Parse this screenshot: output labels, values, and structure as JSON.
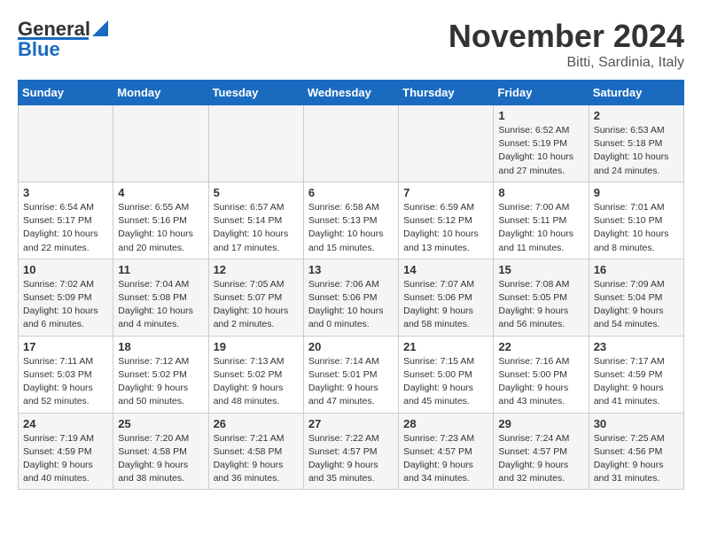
{
  "header": {
    "logo_general": "General",
    "logo_blue": "Blue",
    "month": "November 2024",
    "location": "Bitti, Sardinia, Italy"
  },
  "days_of_week": [
    "Sunday",
    "Monday",
    "Tuesday",
    "Wednesday",
    "Thursday",
    "Friday",
    "Saturday"
  ],
  "weeks": [
    [
      {
        "day": "",
        "info": ""
      },
      {
        "day": "",
        "info": ""
      },
      {
        "day": "",
        "info": ""
      },
      {
        "day": "",
        "info": ""
      },
      {
        "day": "",
        "info": ""
      },
      {
        "day": "1",
        "info": "Sunrise: 6:52 AM\nSunset: 5:19 PM\nDaylight: 10 hours\nand 27 minutes."
      },
      {
        "day": "2",
        "info": "Sunrise: 6:53 AM\nSunset: 5:18 PM\nDaylight: 10 hours\nand 24 minutes."
      }
    ],
    [
      {
        "day": "3",
        "info": "Sunrise: 6:54 AM\nSunset: 5:17 PM\nDaylight: 10 hours\nand 22 minutes."
      },
      {
        "day": "4",
        "info": "Sunrise: 6:55 AM\nSunset: 5:16 PM\nDaylight: 10 hours\nand 20 minutes."
      },
      {
        "day": "5",
        "info": "Sunrise: 6:57 AM\nSunset: 5:14 PM\nDaylight: 10 hours\nand 17 minutes."
      },
      {
        "day": "6",
        "info": "Sunrise: 6:58 AM\nSunset: 5:13 PM\nDaylight: 10 hours\nand 15 minutes."
      },
      {
        "day": "7",
        "info": "Sunrise: 6:59 AM\nSunset: 5:12 PM\nDaylight: 10 hours\nand 13 minutes."
      },
      {
        "day": "8",
        "info": "Sunrise: 7:00 AM\nSunset: 5:11 PM\nDaylight: 10 hours\nand 11 minutes."
      },
      {
        "day": "9",
        "info": "Sunrise: 7:01 AM\nSunset: 5:10 PM\nDaylight: 10 hours\nand 8 minutes."
      }
    ],
    [
      {
        "day": "10",
        "info": "Sunrise: 7:02 AM\nSunset: 5:09 PM\nDaylight: 10 hours\nand 6 minutes."
      },
      {
        "day": "11",
        "info": "Sunrise: 7:04 AM\nSunset: 5:08 PM\nDaylight: 10 hours\nand 4 minutes."
      },
      {
        "day": "12",
        "info": "Sunrise: 7:05 AM\nSunset: 5:07 PM\nDaylight: 10 hours\nand 2 minutes."
      },
      {
        "day": "13",
        "info": "Sunrise: 7:06 AM\nSunset: 5:06 PM\nDaylight: 10 hours\nand 0 minutes."
      },
      {
        "day": "14",
        "info": "Sunrise: 7:07 AM\nSunset: 5:06 PM\nDaylight: 9 hours\nand 58 minutes."
      },
      {
        "day": "15",
        "info": "Sunrise: 7:08 AM\nSunset: 5:05 PM\nDaylight: 9 hours\nand 56 minutes."
      },
      {
        "day": "16",
        "info": "Sunrise: 7:09 AM\nSunset: 5:04 PM\nDaylight: 9 hours\nand 54 minutes."
      }
    ],
    [
      {
        "day": "17",
        "info": "Sunrise: 7:11 AM\nSunset: 5:03 PM\nDaylight: 9 hours\nand 52 minutes."
      },
      {
        "day": "18",
        "info": "Sunrise: 7:12 AM\nSunset: 5:02 PM\nDaylight: 9 hours\nand 50 minutes."
      },
      {
        "day": "19",
        "info": "Sunrise: 7:13 AM\nSunset: 5:02 PM\nDaylight: 9 hours\nand 48 minutes."
      },
      {
        "day": "20",
        "info": "Sunrise: 7:14 AM\nSunset: 5:01 PM\nDaylight: 9 hours\nand 47 minutes."
      },
      {
        "day": "21",
        "info": "Sunrise: 7:15 AM\nSunset: 5:00 PM\nDaylight: 9 hours\nand 45 minutes."
      },
      {
        "day": "22",
        "info": "Sunrise: 7:16 AM\nSunset: 5:00 PM\nDaylight: 9 hours\nand 43 minutes."
      },
      {
        "day": "23",
        "info": "Sunrise: 7:17 AM\nSunset: 4:59 PM\nDaylight: 9 hours\nand 41 minutes."
      }
    ],
    [
      {
        "day": "24",
        "info": "Sunrise: 7:19 AM\nSunset: 4:59 PM\nDaylight: 9 hours\nand 40 minutes."
      },
      {
        "day": "25",
        "info": "Sunrise: 7:20 AM\nSunset: 4:58 PM\nDaylight: 9 hours\nand 38 minutes."
      },
      {
        "day": "26",
        "info": "Sunrise: 7:21 AM\nSunset: 4:58 PM\nDaylight: 9 hours\nand 36 minutes."
      },
      {
        "day": "27",
        "info": "Sunrise: 7:22 AM\nSunset: 4:57 PM\nDaylight: 9 hours\nand 35 minutes."
      },
      {
        "day": "28",
        "info": "Sunrise: 7:23 AM\nSunset: 4:57 PM\nDaylight: 9 hours\nand 34 minutes."
      },
      {
        "day": "29",
        "info": "Sunrise: 7:24 AM\nSunset: 4:57 PM\nDaylight: 9 hours\nand 32 minutes."
      },
      {
        "day": "30",
        "info": "Sunrise: 7:25 AM\nSunset: 4:56 PM\nDaylight: 9 hours\nand 31 minutes."
      }
    ]
  ]
}
